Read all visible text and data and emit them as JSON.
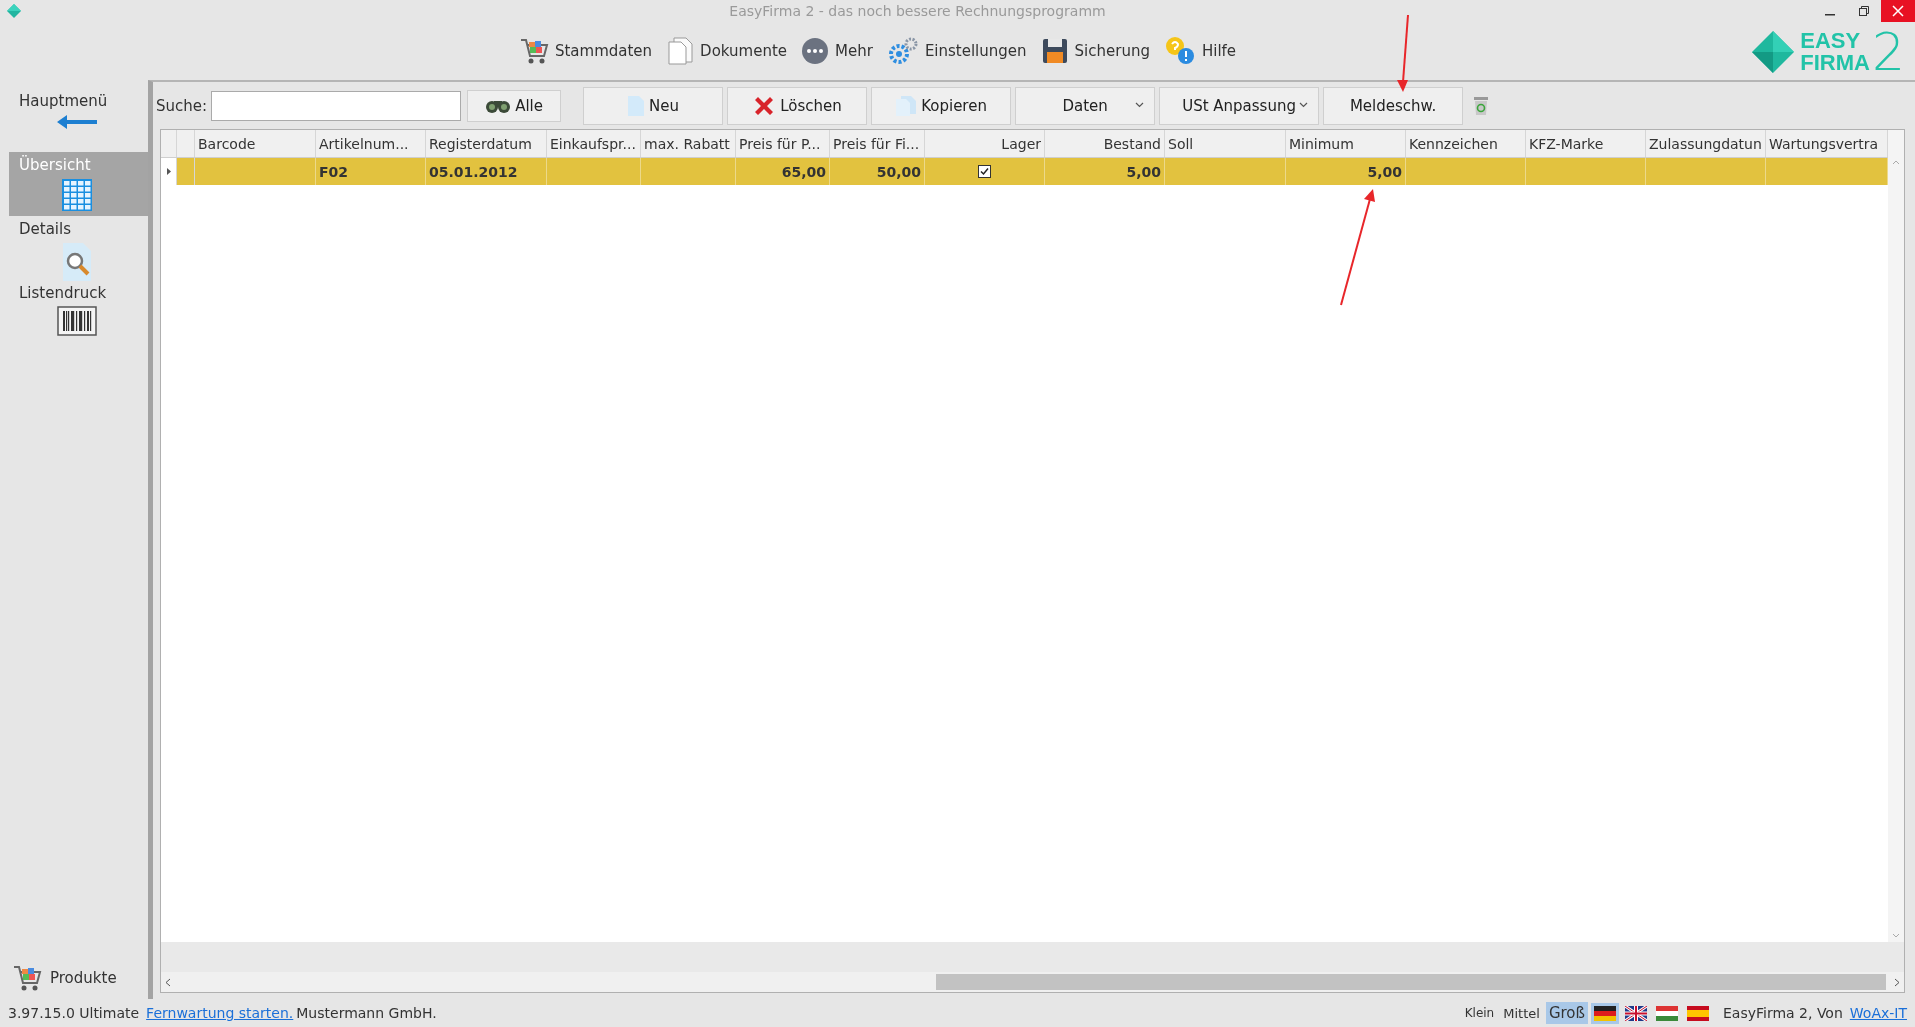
{
  "window": {
    "title": "EasyFirma 2 - das noch bessere Rechnungsprogramm"
  },
  "nav": [
    {
      "label": "Stammdaten",
      "kind": "cart"
    },
    {
      "label": "Dokumente",
      "kind": "documents"
    },
    {
      "label": "Mehr",
      "kind": "more"
    },
    {
      "label": "Einstellungen",
      "kind": "gear"
    },
    {
      "label": "Sicherung",
      "kind": "floppy"
    },
    {
      "label": "Hilfe",
      "kind": "help"
    }
  ],
  "logo": {
    "line1": "EASY",
    "line2": "FIRMA",
    "mark": "2"
  },
  "sidebar": {
    "items": [
      {
        "label": "Hauptmenü",
        "kind": "back",
        "selected": false
      },
      {
        "label": "Übersicht",
        "kind": "grid",
        "selected": true
      },
      {
        "label": "Details",
        "kind": "details",
        "selected": false
      },
      {
        "label": "Listendruck",
        "kind": "barcode",
        "selected": false
      }
    ],
    "module": {
      "label": "Produkte"
    }
  },
  "toolbar": {
    "search_label": "Suche:",
    "search_all": "Alle",
    "buttons": [
      {
        "label": "Neu",
        "kind": "new"
      },
      {
        "label": "Löschen",
        "kind": "delete"
      },
      {
        "label": "Kopieren",
        "kind": "copy"
      },
      {
        "label": "Daten",
        "kind": "dropdown"
      },
      {
        "label": "USt Anpassung",
        "kind": "dropdown"
      },
      {
        "label": "Meldeschw.",
        "kind": "plain"
      }
    ]
  },
  "table": {
    "columns": [
      "Barcode",
      "Artikelnum...",
      "Registerdatum",
      "Einkaufspr...",
      "max. Rabatt",
      "Preis für P...",
      "Preis für Fi...",
      "Lager",
      "Bestand",
      "Soll",
      "Minimum",
      "Kennzeichen",
      "KFZ-Marke",
      "Zulassungdatun",
      "Wartungsvertra"
    ],
    "rows": [
      {
        "selected": true,
        "cells": [
          {
            "kind": "empty"
          },
          {
            "kind": "text",
            "text": "F02"
          },
          {
            "kind": "text",
            "text": "05.01.2012"
          },
          {
            "kind": "empty"
          },
          {
            "kind": "empty"
          },
          {
            "kind": "text",
            "text": "65,00"
          },
          {
            "kind": "text",
            "text": "50,00"
          },
          {
            "kind": "check",
            "checked": true
          },
          {
            "kind": "text",
            "text": "5,00"
          },
          {
            "kind": "empty"
          },
          {
            "kind": "text",
            "text": "5,00"
          },
          {
            "kind": "empty"
          },
          {
            "kind": "empty"
          },
          {
            "kind": "empty"
          },
          {
            "kind": "empty"
          }
        ]
      }
    ]
  },
  "status_bar": {
    "version": "3.97.15.0 Ultimate",
    "remote_link": "Fernwartung starten.",
    "company": "Mustermann GmbH.",
    "sizes": [
      {
        "label": "Klein",
        "selected": false
      },
      {
        "label": "Mittel",
        "selected": false
      },
      {
        "label": "Groß",
        "selected": true
      }
    ],
    "languages": [
      {
        "kind": "de",
        "selected": true
      },
      {
        "kind": "en",
        "selected": false
      },
      {
        "kind": "hu",
        "selected": false
      },
      {
        "kind": "es",
        "selected": false
      }
    ],
    "credit": "EasyFirma 2, Von",
    "vendor_link": "WoAx-IT"
  }
}
